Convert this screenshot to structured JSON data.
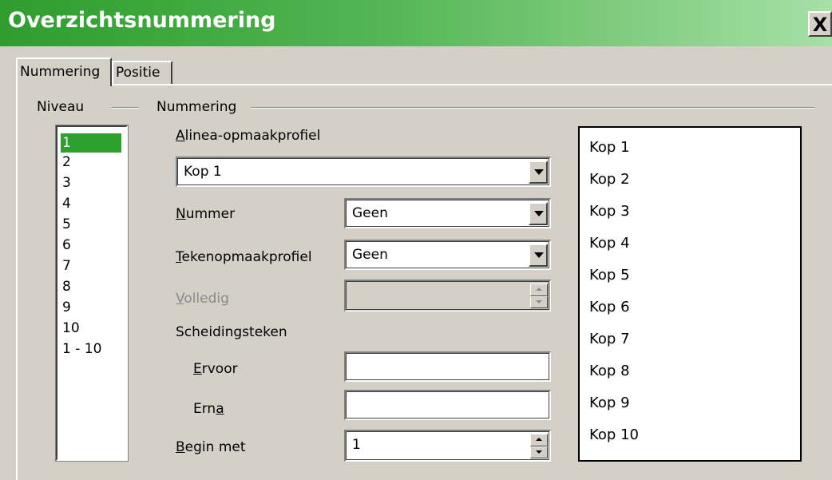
{
  "window": {
    "title": "Overzichtsnummering",
    "close_label": "X"
  },
  "tabs": [
    {
      "label": "Nummering",
      "active": true
    },
    {
      "label": "Positie",
      "active": false
    }
  ],
  "level_group": {
    "label": "Niveau",
    "items": [
      "1",
      "2",
      "3",
      "4",
      "5",
      "6",
      "7",
      "8",
      "9",
      "10",
      "1 - 10"
    ],
    "selected": "1"
  },
  "numbering_group": {
    "label": "Nummering",
    "paragraph_style": {
      "label": "Alinea-opmaakprofiel",
      "value": "Kop 1"
    },
    "number": {
      "label": "Nummer",
      "value": "Geen"
    },
    "char_style": {
      "label": "Tekenopmaakprofiel",
      "value": "Geen"
    },
    "show_sublevels": {
      "label": "Volledig",
      "value": "",
      "enabled": false
    },
    "separator": {
      "label": "Scheidingsteken",
      "before": {
        "label": "Ervoor",
        "value": ""
      },
      "after": {
        "label": "Erna",
        "value": ""
      }
    },
    "start_at": {
      "label": "Begin met",
      "value": "1"
    }
  },
  "preview": {
    "items": [
      "Kop 1",
      "Kop 2",
      "Kop 3",
      "Kop 4",
      "Kop 5",
      "Kop 6",
      "Kop 7",
      "Kop 8",
      "Kop 9",
      "Kop 10"
    ]
  },
  "colors": {
    "accent": "#2ea02e",
    "dialog_bg": "#d4d0c8"
  }
}
